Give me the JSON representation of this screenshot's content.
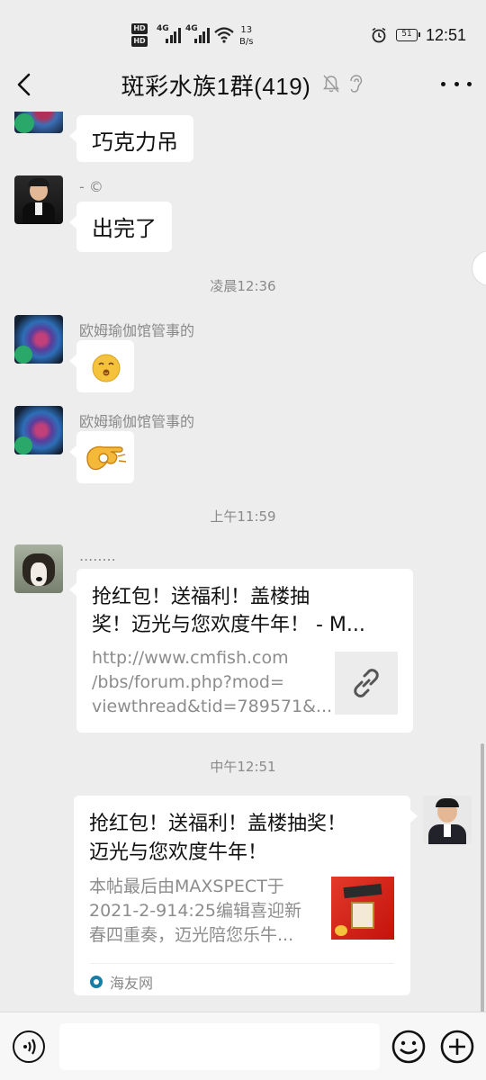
{
  "status_bar": {
    "hd_labels": [
      "HD",
      "HD"
    ],
    "sim1_network": "4G",
    "sim2_network": "4G",
    "speed_value": "13",
    "speed_unit": "B/s",
    "battery": "51",
    "time": "12:51"
  },
  "header": {
    "title": "斑彩水族1群(419)",
    "icons": [
      "back-icon",
      "mute-icon",
      "ear-icon",
      "more-icon"
    ]
  },
  "messages": [
    {
      "type": "text",
      "text": "巧克力吊"
    },
    {
      "type": "text",
      "sender": "- ©",
      "text": "出完了"
    },
    {
      "type": "time",
      "text": "凌晨12:36"
    },
    {
      "type": "sticker",
      "sender": "欧姆瑜伽馆管事的",
      "icon": "kiss-emoji-icon"
    },
    {
      "type": "sticker",
      "sender": "欧姆瑜伽馆管事的",
      "icon": "ok-hand-emoji-icon"
    },
    {
      "type": "time",
      "text": "上午11:59"
    },
    {
      "type": "link",
      "sender": "........",
      "title": "抢红包！送福利！盖楼抽奖！迈光与您欢度牛年！ - M...",
      "title_line1": "抢红包！送福利！盖楼抽",
      "title_line2": "奖！迈光与您欢度牛年！ - M...",
      "desc_line1": "http://www.cmfish.com",
      "desc_line2": "/bbs/forum.php?mod=",
      "desc_line3": "viewthread&tid=789571&...",
      "thumb_icon": "link-icon"
    },
    {
      "type": "time",
      "text": "中午12:51"
    },
    {
      "type": "link-self",
      "title_line1": "抢红包！送福利！盖楼抽奖！",
      "title_line2": "迈光与您欢度牛年！",
      "desc_line1": "本帖最后由MAXSPECT于",
      "desc_line2": "2021-2-914:25编辑喜迎新",
      "desc_line3": "春四重奏，迈光陪您乐牛...",
      "source": "海友网"
    }
  ],
  "input_bar": {
    "placeholder": "",
    "icons": [
      "voice-icon",
      "emoji-icon",
      "plus-icon"
    ]
  },
  "colors": {
    "background": "#ededed",
    "bubble": "#ffffff",
    "timestamp": "#8a8a8a",
    "source_brand": "#1a7da6"
  }
}
